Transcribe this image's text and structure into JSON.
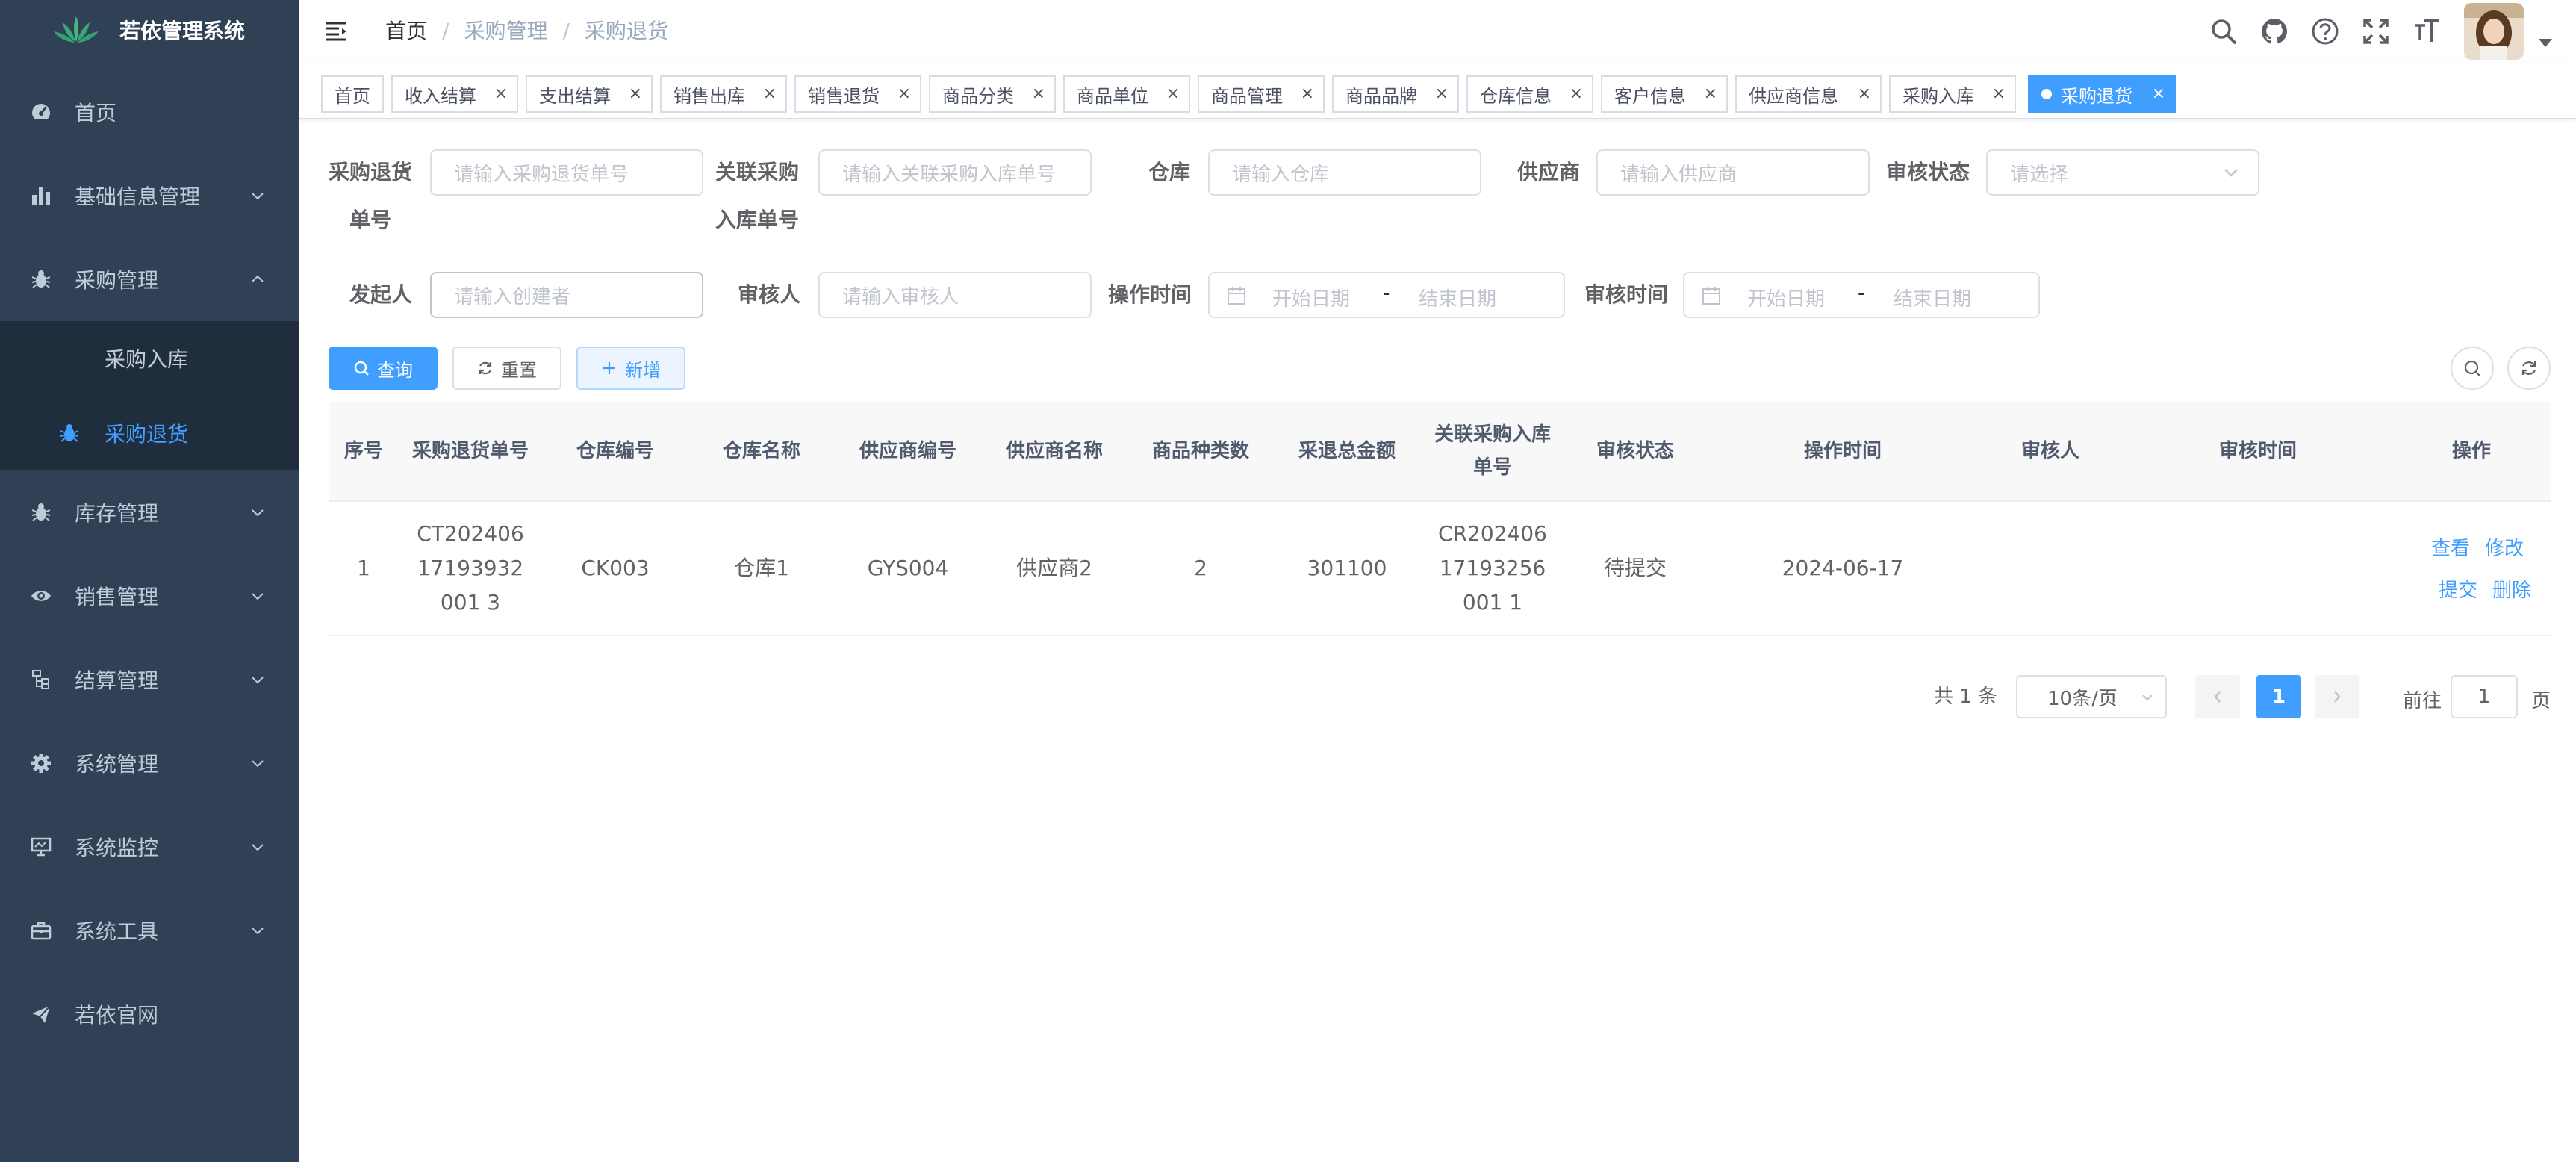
{
  "app": {
    "title": "若依管理系统"
  },
  "sidebar": {
    "items": [
      {
        "label": "首页",
        "icon": "dashboard-icon"
      },
      {
        "label": "基础信息管理",
        "icon": "bar-chart-icon"
      },
      {
        "label": "采购管理",
        "icon": "bug-icon",
        "expanded": true
      },
      {
        "label": "库存管理",
        "icon": "bug-icon"
      },
      {
        "label": "销售管理",
        "icon": "eye-icon"
      },
      {
        "label": "结算管理",
        "icon": "tree-icon"
      },
      {
        "label": "系统管理",
        "icon": "gear-icon"
      },
      {
        "label": "系统监控",
        "icon": "monitor-icon"
      },
      {
        "label": "系统工具",
        "icon": "toolbox-icon"
      },
      {
        "label": "若依官网",
        "icon": "send-icon"
      }
    ],
    "submenu": [
      {
        "label": "采购入库"
      },
      {
        "label": "采购退货",
        "active": true
      }
    ]
  },
  "breadcrumb": {
    "items": [
      "首页",
      "采购管理",
      "采购退货"
    ]
  },
  "tags": [
    {
      "label": "首页"
    },
    {
      "label": "收入结算"
    },
    {
      "label": "支出结算"
    },
    {
      "label": "销售出库"
    },
    {
      "label": "销售退货"
    },
    {
      "label": "商品分类"
    },
    {
      "label": "商品单位"
    },
    {
      "label": "商品管理"
    },
    {
      "label": "商品品牌"
    },
    {
      "label": "仓库信息"
    },
    {
      "label": "客户信息"
    },
    {
      "label": "供应商信息"
    },
    {
      "label": "采购入库"
    },
    {
      "label": "采购退货",
      "active": true
    }
  ],
  "form": {
    "return_no": {
      "label_1": "采购退货",
      "label_2": "单号",
      "placeholder": "请输入采购退货单号"
    },
    "inbound_no": {
      "label_1": "关联采购",
      "label_2": "入库单号",
      "placeholder": "请输入关联采购入库单号"
    },
    "warehouse": {
      "label": "仓库",
      "placeholder": "请输入仓库"
    },
    "supplier": {
      "label": "供应商",
      "placeholder": "请输入供应商"
    },
    "audit_status": {
      "label": "审核状态",
      "placeholder": "请选择"
    },
    "creator": {
      "label": "发起人",
      "placeholder": "请输入创建者"
    },
    "auditor": {
      "label": "审核人",
      "placeholder": "请输入审核人"
    },
    "op_time": {
      "label": "操作时间",
      "start": "开始日期",
      "sep": "-",
      "end": "结束日期"
    },
    "audit_time": {
      "label": "审核时间",
      "start": "开始日期",
      "sep": "-",
      "end": "结束日期"
    }
  },
  "buttons": {
    "search": "查询",
    "reset": "重置",
    "add": "新增"
  },
  "table": {
    "columns": [
      "序号",
      "采购退货单号",
      "仓库编号",
      "仓库名称",
      "供应商编号",
      "供应商名称",
      "商品种类数",
      "采退总金额",
      "关联采购入库单号",
      "审核状态",
      "操作时间",
      "审核人",
      "审核时间",
      "操作"
    ],
    "rows": [
      {
        "index": "1",
        "return_no": "CT20240617193932001 3",
        "warehouse_code": "CK003",
        "warehouse_name": "仓库1",
        "supplier_code": "GYS004",
        "supplier_name": "供应商2",
        "item_kinds": "2",
        "total_amount": "301100",
        "inbound_no": "CR20240617193256001 1",
        "audit_status": "待提交",
        "op_time": "2024-06-17",
        "auditor": "",
        "audit_time": "",
        "ops": {
          "view": "查看",
          "edit": "修改",
          "submit": "提交",
          "delete": "删除"
        }
      }
    ]
  },
  "pagination": {
    "total": "共 1 条",
    "page_size": "10条/页",
    "current": "1",
    "goto_label": "前往",
    "goto_value": "1",
    "goto_suffix": "页"
  },
  "colors": {
    "sidebar_bg": "#304156",
    "submenu_bg": "#1f2d3d",
    "primary": "#409eff",
    "text": "#606266"
  }
}
